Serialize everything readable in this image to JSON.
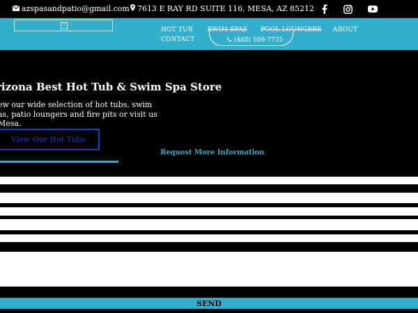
{
  "topbar": {
    "email": "azspasandpatio@gmail.com",
    "address": "7613 E RAY RD SUITE 116, MESA, AZ 85212",
    "icons": [
      "envelope-icon",
      "map-pin-icon",
      "facebook-icon",
      "instagram-icon",
      "youtube-icon"
    ]
  },
  "nav": {
    "logo_glyph": "?",
    "items": [
      "HOT TUB",
      "SWIM SPAS",
      "POOL LOUNGERS",
      "ABOUT",
      "CONTACT"
    ],
    "phone": "(480) 509-7735"
  },
  "hero": {
    "title": "rizona Best Hot Tub & Swim Spa Store",
    "paragraph": "ew our wide selection of hot tubs, swim as, patio loungers and fire pits or visit us Mesa.",
    "button": "View Our Hot Tubs",
    "request": "Request More Information"
  },
  "form": {
    "send": "SEND"
  },
  "colors": {
    "accent": "#33aecb",
    "background": "#000000",
    "button_border": "#1a3bd8"
  }
}
